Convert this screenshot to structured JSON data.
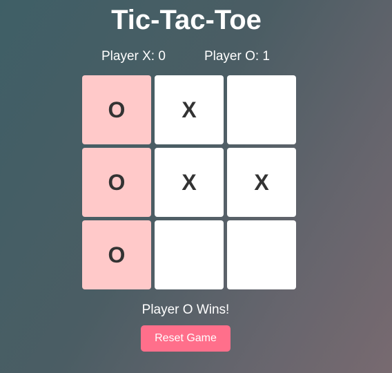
{
  "title": "Tic-Tac-Toe",
  "scores": {
    "x_label": "Player X: 0",
    "o_label": "Player O: 1"
  },
  "board": {
    "cells": [
      "O",
      "X",
      "",
      "O",
      "X",
      "X",
      "O",
      "",
      ""
    ],
    "winning_cells": [
      0,
      3,
      6
    ]
  },
  "status": "Player O Wins!",
  "reset_label": "Reset Game",
  "colors": {
    "win_highlight": "#ffc9c9",
    "cell": "#ffffff",
    "mark": "#333333",
    "reset_button": "#ff6f8b"
  }
}
